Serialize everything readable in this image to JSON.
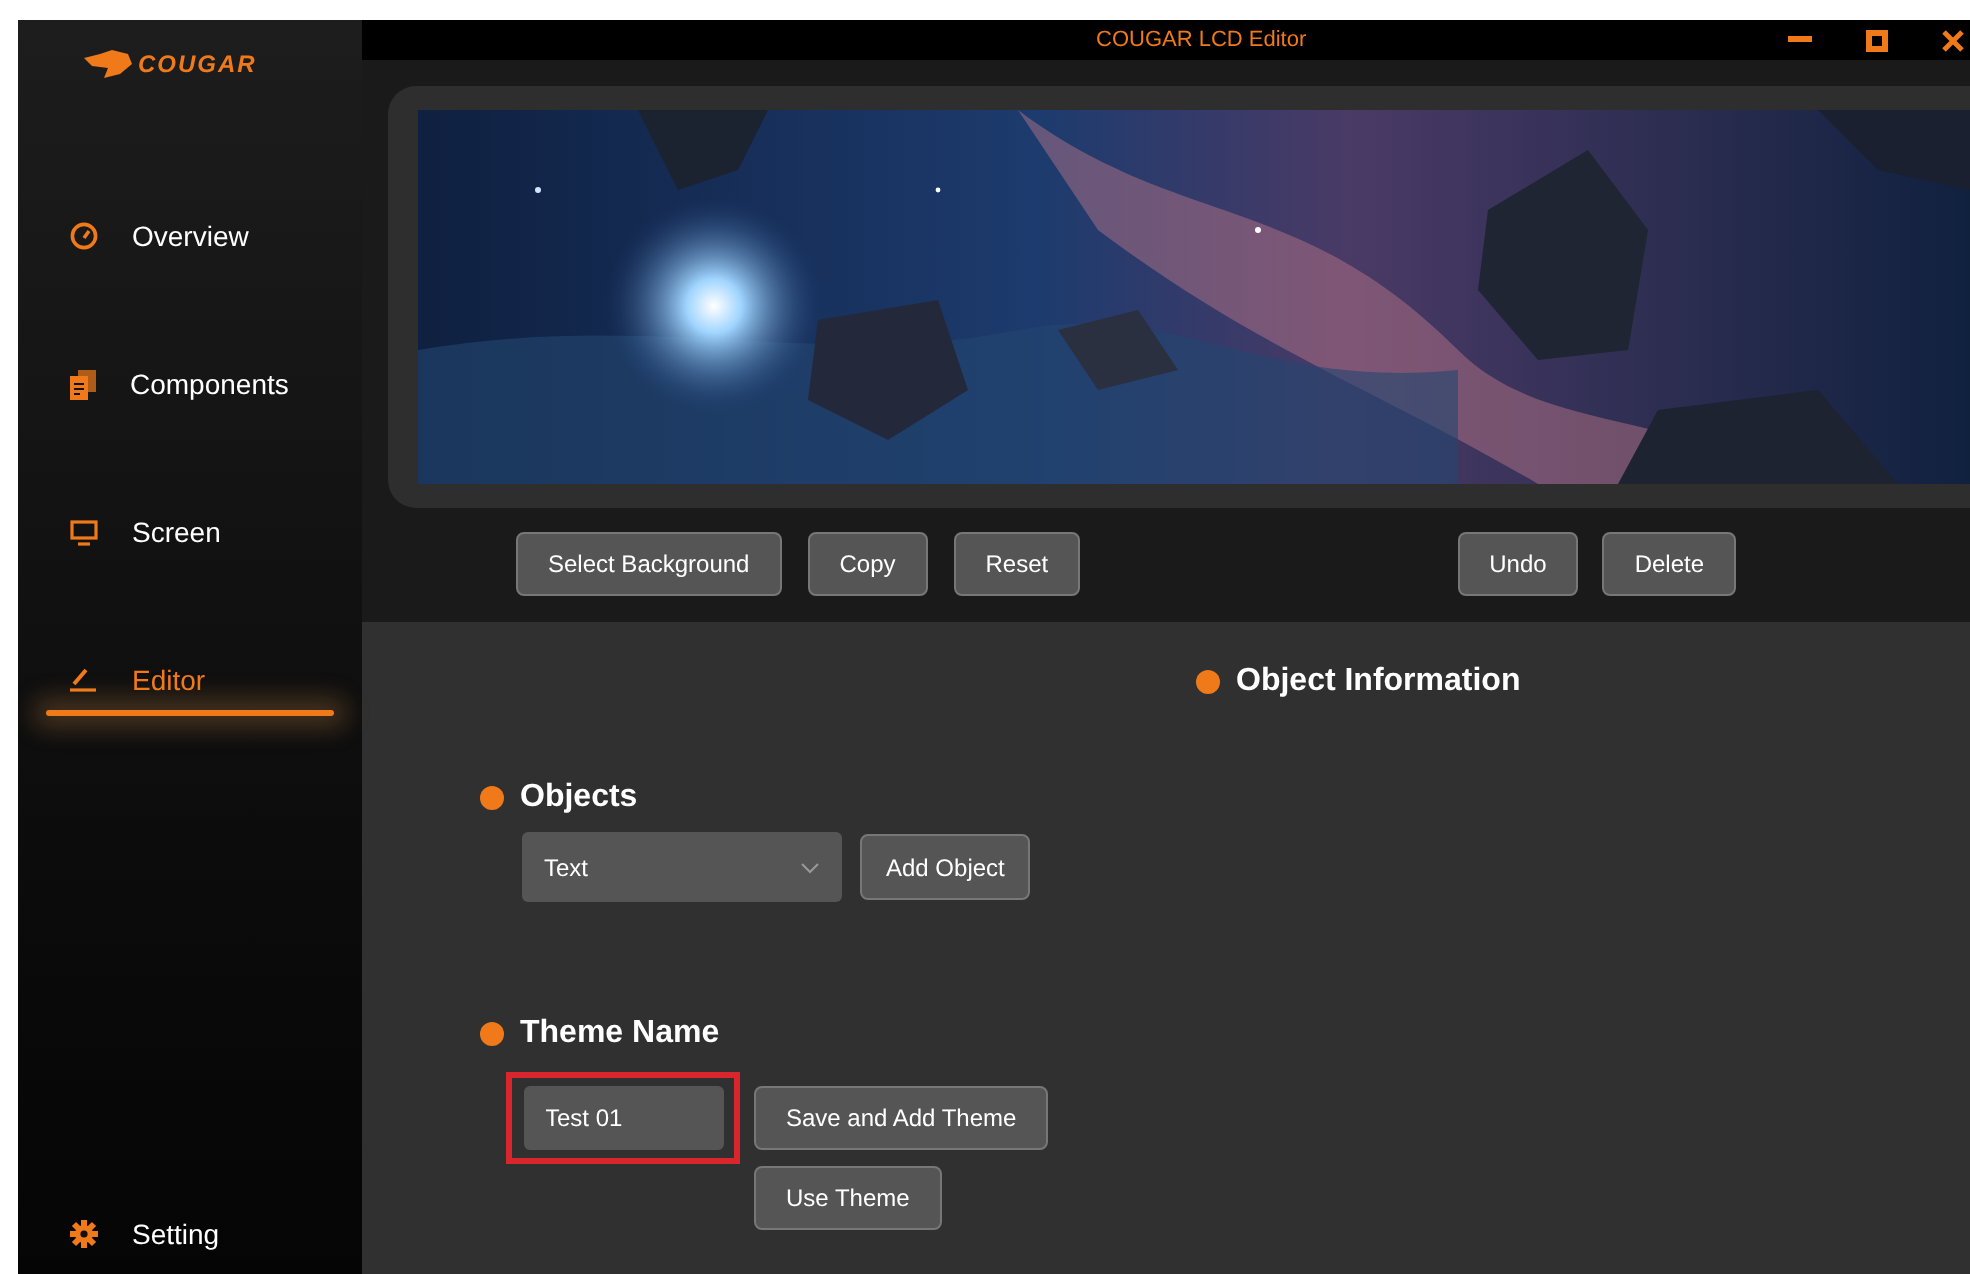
{
  "window": {
    "title": "COUGAR LCD Editor"
  },
  "sidebar": {
    "logo": "COUGAR",
    "items": [
      {
        "label": "Overview",
        "selected": false
      },
      {
        "label": "Components",
        "selected": false
      },
      {
        "label": "Screen",
        "selected": false
      },
      {
        "label": "Editor",
        "selected": true
      }
    ],
    "footer_item": {
      "label": "Setting"
    }
  },
  "toolbar": {
    "left": [
      "Select Background",
      "Copy",
      "Reset"
    ],
    "right": [
      "Undo",
      "Delete"
    ]
  },
  "object_information": {
    "title": "Object Information"
  },
  "objects": {
    "title": "Objects",
    "dropdown": {
      "value": "Text"
    },
    "button": "Add Object"
  },
  "theme": {
    "title": "Theme Name",
    "field": {
      "value": "Test 01",
      "highlighted": true
    },
    "buttons": [
      "Save and Add Theme",
      "Use Theme"
    ]
  }
}
